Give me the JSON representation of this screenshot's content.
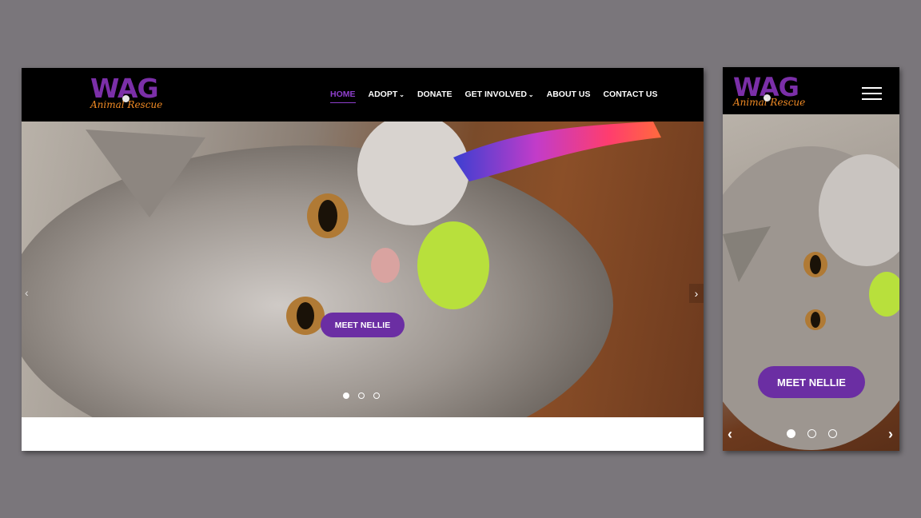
{
  "brand": {
    "name": "WAG",
    "subtitle": "Animal Rescue"
  },
  "nav": {
    "items": [
      {
        "label": "HOME",
        "active": true,
        "has_dropdown": false
      },
      {
        "label": "ADOPT",
        "active": false,
        "has_dropdown": true
      },
      {
        "label": "DONATE",
        "active": false,
        "has_dropdown": false
      },
      {
        "label": "GET INVOLVED",
        "active": false,
        "has_dropdown": true
      },
      {
        "label": "ABOUT US",
        "active": false,
        "has_dropdown": false
      },
      {
        "label": "CONTACT US",
        "active": false,
        "has_dropdown": false
      }
    ],
    "dropdown_icon": "chevron-down-icon"
  },
  "hero": {
    "cta_label": "MEET NELLIE",
    "slide_count": 3,
    "active_slide": 1,
    "prev_icon": "chevron-left-icon",
    "next_icon": "chevron-right-icon"
  },
  "mobile": {
    "menu_icon": "hamburger-menu-icon"
  },
  "colors": {
    "background": "#7a767b",
    "header": "#000000",
    "brand_purple": "#7b2fa8",
    "brand_orange": "#f08a24",
    "accent": "#6b2ea3",
    "nav_active": "#8e3fcc"
  }
}
